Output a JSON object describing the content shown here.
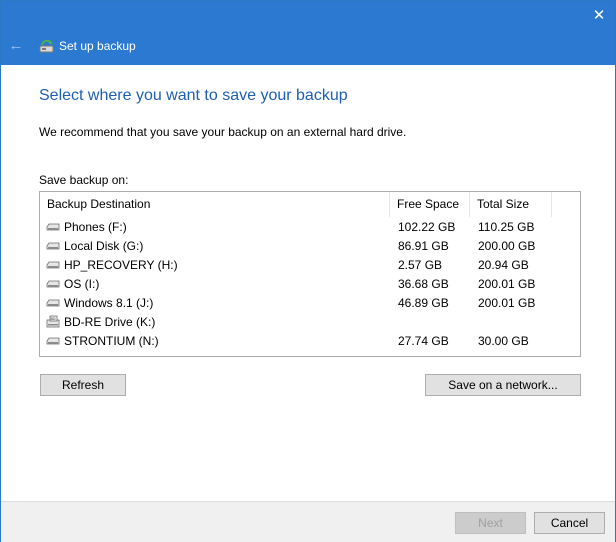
{
  "window": {
    "title": "Set up backup"
  },
  "main": {
    "heading": "Select where you want to save your backup",
    "recommendation": "We recommend that you save your backup on an external hard drive.",
    "save_label": "Save backup on:"
  },
  "table": {
    "columns": [
      "Backup Destination",
      "Free Space",
      "Total Size"
    ],
    "rows": [
      {
        "icon": "hard-drive-icon",
        "name": "Phones (F:)",
        "free": "102.22 GB",
        "total": "110.25 GB"
      },
      {
        "icon": "hard-drive-icon",
        "name": "Local Disk (G:)",
        "free": "86.91 GB",
        "total": "200.00 GB"
      },
      {
        "icon": "hard-drive-icon",
        "name": "HP_RECOVERY (H:)",
        "free": "2.57 GB",
        "total": "20.94 GB"
      },
      {
        "icon": "hard-drive-icon",
        "name": "OS (I:)",
        "free": "36.68 GB",
        "total": "200.01 GB"
      },
      {
        "icon": "hard-drive-icon",
        "name": "Windows 8.1 (J:)",
        "free": "46.89 GB",
        "total": "200.01 GB"
      },
      {
        "icon": "bd-drive-icon",
        "name": "BD-RE Drive (K:)",
        "free": "",
        "total": ""
      },
      {
        "icon": "hard-drive-icon",
        "name": "STRONTIUM (N:)",
        "free": "27.74 GB",
        "total": "30.00 GB"
      }
    ]
  },
  "buttons": {
    "refresh": "Refresh",
    "save_network": "Save on a network...",
    "next": "Next",
    "cancel": "Cancel"
  },
  "colors": {
    "titlebar": "#2b79d0",
    "heading": "#1d5fb6"
  }
}
